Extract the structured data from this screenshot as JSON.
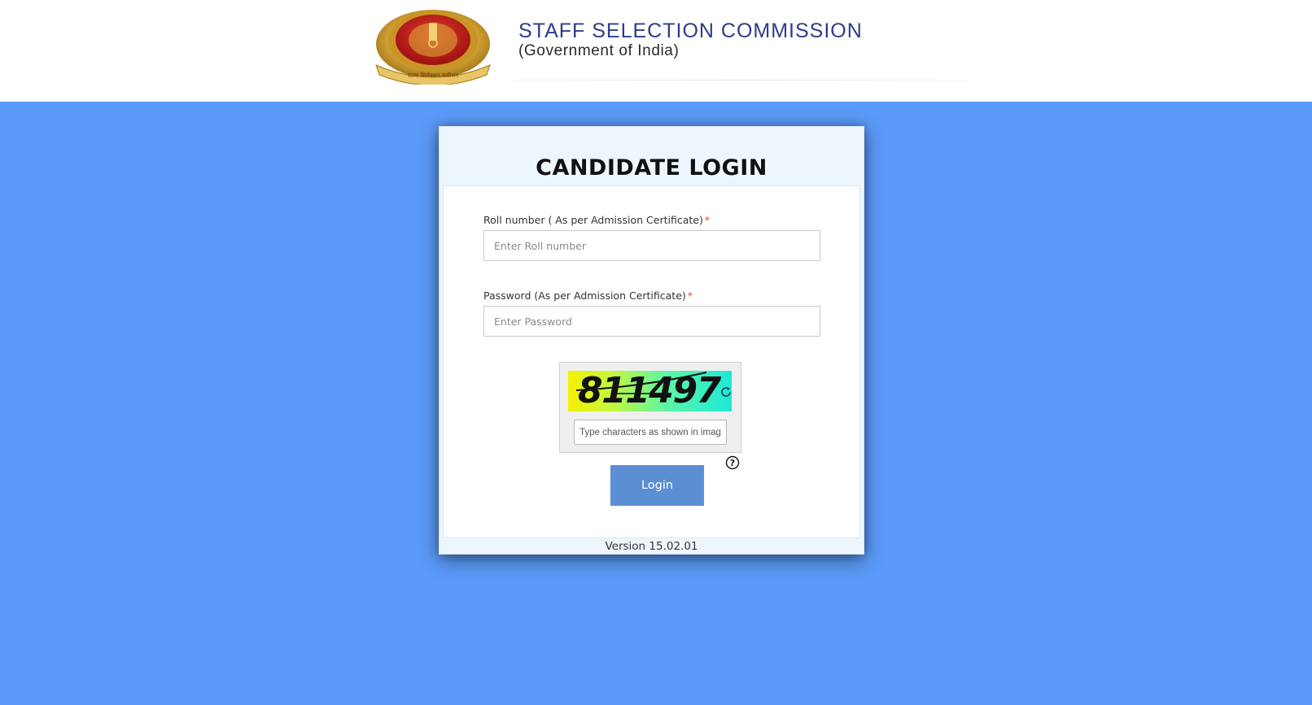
{
  "header": {
    "title": "STAFF SELECTION COMMISSION",
    "subtitle": "(Government of India)",
    "emblem_icon": "ssc-emblem-icon",
    "emblem_text": "स्टाफ सिलेक्शन कमीशन"
  },
  "login": {
    "title": "CANDIDATE LOGIN",
    "roll_label": "Roll number ( As per Admission Certificate)",
    "roll_placeholder": "Enter Roll number",
    "roll_value": "",
    "password_label": "Password (As per Admission Certificate)",
    "password_placeholder": "Enter Password",
    "password_value": "",
    "required_mark": "*",
    "captcha": {
      "code": "811497",
      "placeholder": "Type characters as shown in image",
      "value": "",
      "refresh_icon": "refresh-icon",
      "help_icon": "help-icon"
    },
    "button_label": "Login",
    "version": "Version 15.02.01"
  },
  "colors": {
    "background": "#5b9af8",
    "header_text": "#2d3c8c",
    "button": "#5b8fd4",
    "required": "#e8432a"
  }
}
